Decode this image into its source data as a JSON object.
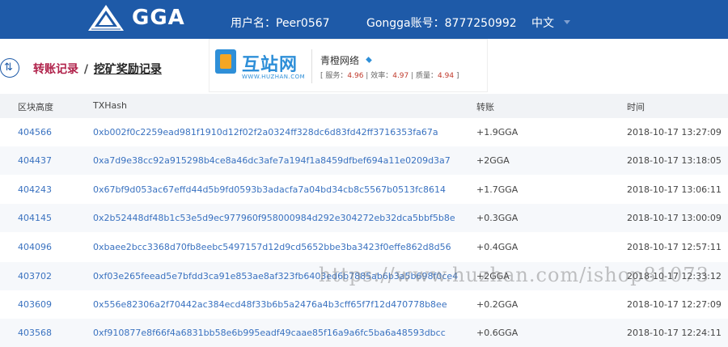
{
  "header": {
    "logo_text": "GGA",
    "username": "用户名：Peer0567",
    "account": "Gongga账号：8777250992",
    "language": "中文"
  },
  "breadcrumb": {
    "transfer": "转账记录",
    "separator": "/",
    "mining": "挖矿奖励记录"
  },
  "badge": {
    "site_name": "互站网",
    "site_url": "WWW.HUZHAN.COM",
    "shop_title": "青橙网络",
    "scores": {
      "service_label": "服务：",
      "service": "4.96",
      "efficiency_label": "效率：",
      "efficiency": "4.97",
      "quality_label": "质量：",
      "quality": "4.94"
    }
  },
  "table": {
    "columns": [
      "区块高度",
      "TXHash",
      "转账",
      "时间"
    ],
    "rows": [
      {
        "height": "404566",
        "hash": "0xb002f0c2259ead981f1910d12f02f2a0324ff328dc6d83fd42ff3716353fa67a",
        "amount": "+1.9GGA",
        "time": "2018-10-17 13:27:09"
      },
      {
        "height": "404437",
        "hash": "0xa7d9e38cc92a915298b4ce8a46dc3afe7a194f1a8459dfbef694a11e0209d3a7",
        "amount": "+2GGA",
        "time": "2018-10-17 13:18:05"
      },
      {
        "height": "404243",
        "hash": "0x67bf9d053ac67effd44d5b9fd0593b3adacfa7a04bd34cb8c5567b0513fc8614",
        "amount": "+1.7GGA",
        "time": "2018-10-17 13:06:11"
      },
      {
        "height": "404145",
        "hash": "0x2b52448df48b1c53e5d9ec977960f958000984d292e304272eb32dca5bbf5b8e",
        "amount": "+0.3GGA",
        "time": "2018-10-17 13:00:09"
      },
      {
        "height": "404096",
        "hash": "0xbaee2bcc3368d70fb8eebc5497157d12d9cd5652bbe3ba3423f0effe862d8d56",
        "amount": "+0.4GGA",
        "time": "2018-10-17 12:57:11"
      },
      {
        "height": "403702",
        "hash": "0xf03e265feead5e7bfdd3ca91e853ae8af323fb6403ed6b7885ab6b3a5b698f0ce4",
        "amount": "+2GGA",
        "time": "2018-10-17 12:33:12"
      },
      {
        "height": "403609",
        "hash": "0x556e82306a2f70442ac384ecd48f33b6b5a2476a4b3cff65f7f12d470778b8ee",
        "amount": "+0.2GGA",
        "time": "2018-10-17 12:27:09"
      },
      {
        "height": "403568",
        "hash": "0xf910877e8f66f4a6831bb58e6b995eadf49caae85f16a9a6fc5ba6a48593dbcc",
        "amount": "+0.6GGA",
        "time": "2018-10-17 12:24:11"
      }
    ]
  },
  "watermark": "https://www.huzhan.com/ishop81073",
  "colors": {
    "header_bg": "#1e5aa8",
    "link_blue": "#3a72c0",
    "crumb_red": "#b0214a"
  }
}
